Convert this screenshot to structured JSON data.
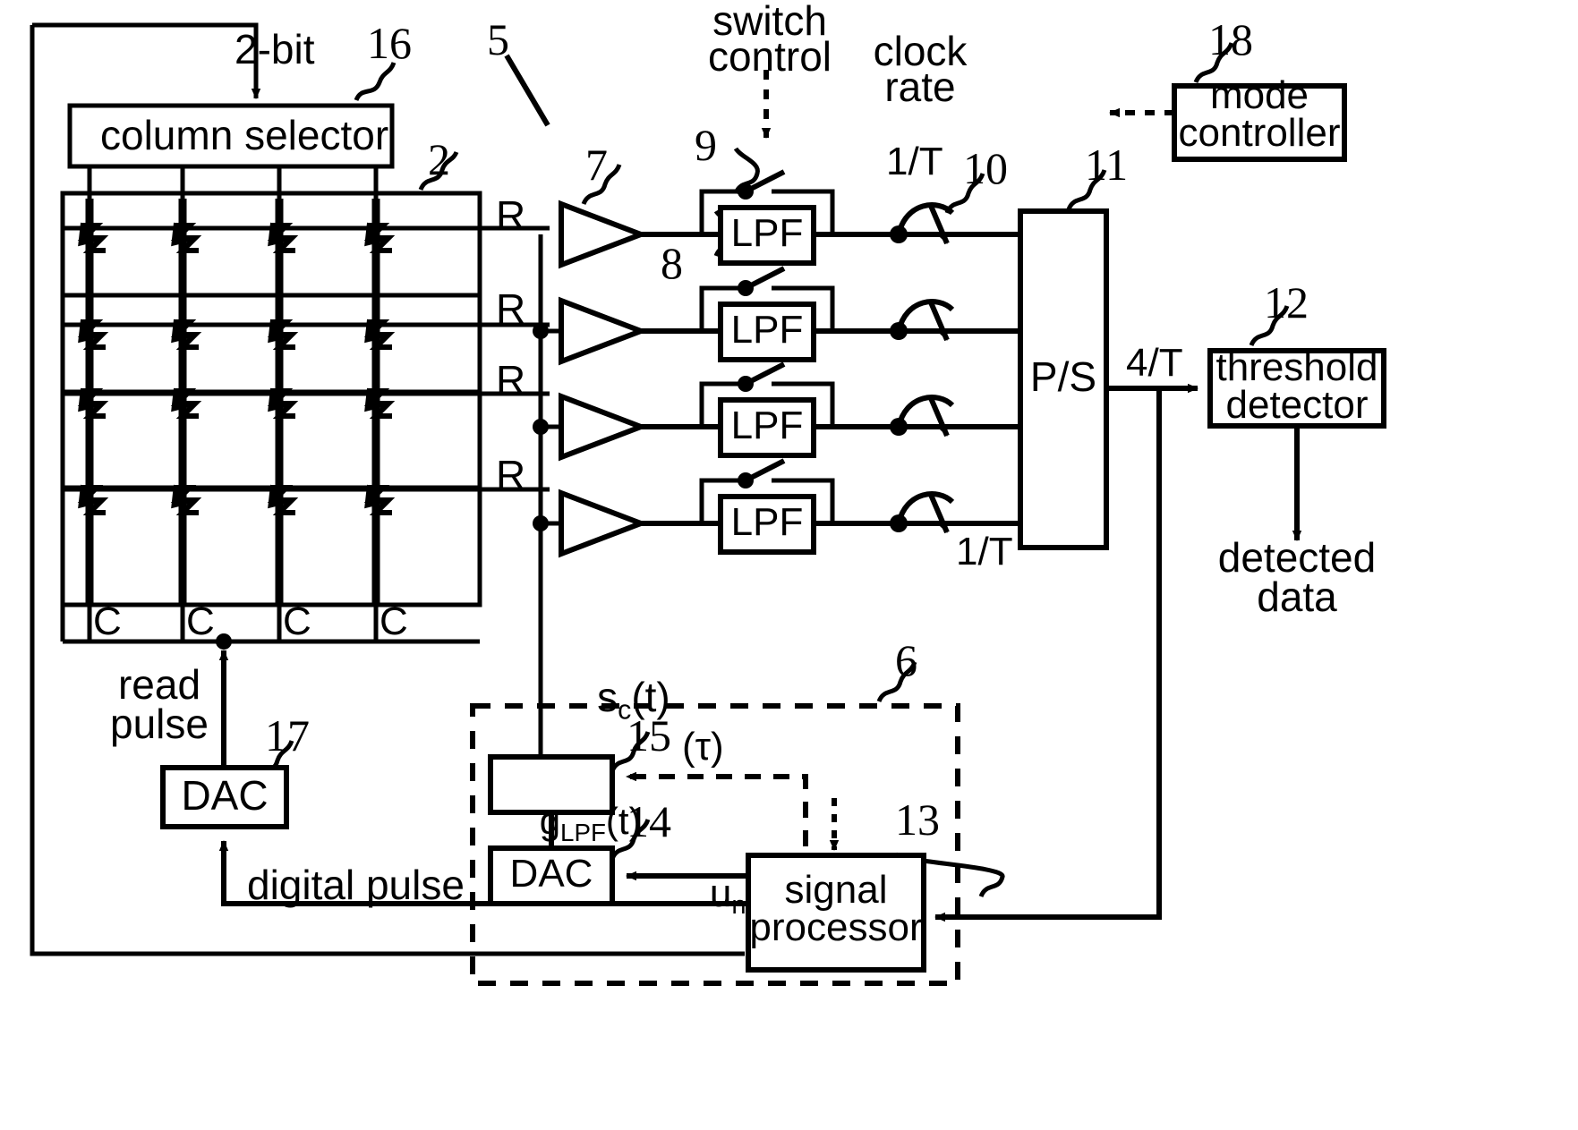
{
  "figure": {
    "type": "patent-block-diagram",
    "title_visible": false
  },
  "blocks": [
    {
      "id": "column_selector",
      "label": "column selector",
      "ref": "16"
    },
    {
      "id": "memory_array",
      "label": "",
      "ref": "2"
    },
    {
      "id": "lpf1",
      "label": "LPF",
      "ref": "8"
    },
    {
      "id": "lpf2",
      "label": "LPF",
      "ref": ""
    },
    {
      "id": "lpf3",
      "label": "LPF",
      "ref": ""
    },
    {
      "id": "lpf4",
      "label": "LPF",
      "ref": ""
    },
    {
      "id": "ps",
      "label": "P/S",
      "ref": "11"
    },
    {
      "id": "threshold_detector",
      "label": "threshold\ndetector",
      "ref": "12"
    },
    {
      "id": "mode_controller",
      "label": "mode\ncontroller",
      "ref": "18"
    },
    {
      "id": "dac_read",
      "label": "DAC",
      "ref": "17"
    },
    {
      "id": "g_lpf",
      "label": "g_LPF(t)",
      "ref": "15"
    },
    {
      "id": "dac_inner",
      "label": "DAC",
      "ref": "14"
    },
    {
      "id": "signal_processor",
      "label": "signal\nprocessor",
      "ref": "13"
    }
  ],
  "labels": {
    "two_bit": "2-bit",
    "column_selector": "column selector",
    "switch_control_l1": "switch",
    "switch_control_l2": "control",
    "clock_rate_l1": "clock",
    "clock_rate_l2": "rate",
    "mode_controller_l1": "mode",
    "mode_controller_l2": "controller",
    "lpf": "LPF",
    "ps": "P/S",
    "threshold_l1": "threshold",
    "threshold_l2": "detector",
    "detected_l1": "detected",
    "detected_l2": "data",
    "rate_1T_top": "1/T",
    "rate_1T_bottom": "1/T",
    "rate_4T": "4/T",
    "row_R": "R",
    "col_C": "C",
    "sc_t": "s",
    "sc_t_sub": "c",
    "sc_t_tail": "(t)",
    "g_lpf_main": "g",
    "g_lpf_sub": "LPF",
    "g_lpf_tail": "(t)",
    "tau": "(τ)",
    "u_n_main": "u",
    "u_n_sub": "n",
    "dac": "DAC",
    "read_pulse_l1": "read",
    "read_pulse_l2": "pulse",
    "digital_pulse": "digital pulse",
    "signal_processor_l1": "signal",
    "signal_processor_l2": "processor"
  },
  "reference_numerals": {
    "n2": "2",
    "n5": "5",
    "n6": "6",
    "n7": "7",
    "n8": "8",
    "n9": "9",
    "n10": "10",
    "n11": "11",
    "n12": "12",
    "n13": "13",
    "n14": "14",
    "n15": "15",
    "n16": "16",
    "n17": "17",
    "n18": "18"
  },
  "memory_array": {
    "rows": 4,
    "columns": 4,
    "row_labels": [
      "R",
      "R",
      "R",
      "R"
    ],
    "column_labels": [
      "C",
      "C",
      "C",
      "C"
    ],
    "cell_symbol": "diode-resistor"
  },
  "channels": {
    "count": 4,
    "row_label": "R",
    "amplifier_ref": "7",
    "filter_label": "LPF",
    "bypass_switch_ref": "9",
    "sampler_ref": "10"
  },
  "colors": {
    "ink": "#000000",
    "background": "#ffffff"
  }
}
